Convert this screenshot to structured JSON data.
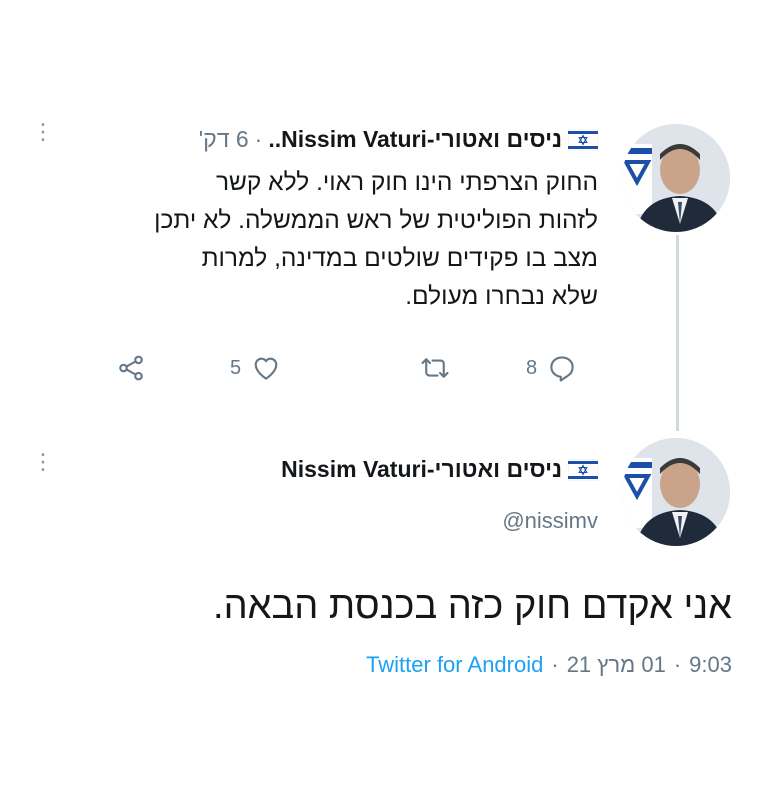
{
  "tweet1": {
    "display_name": "ניסים ואטורי-Nissim Vaturi..",
    "separator": "·",
    "time": "6 דק'",
    "text_lines": [
      "החוק הצרפתי הינו חוק ראוי. ללא קשר",
      "לזהות הפוליטית של ראש הממשלה. לא יתכן",
      "מצב בו פקידים שולטים במדינה, למרות",
      "שלא נבחרו מעולם."
    ],
    "reply_count": "8",
    "retweet_count": "",
    "like_count": "5"
  },
  "tweet2": {
    "display_name": "ניסים ואטורי-Nissim Vaturi",
    "handle": "@nissimv",
    "text": "אני אקדם חוק כזה בכנסת הבאה.",
    "time": "9:03",
    "date": "01 מרץ 21",
    "source": "Twitter for Android",
    "separator": "·"
  },
  "icons": [
    "israel-flag-icon",
    "more-options-icon",
    "reply-icon",
    "retweet-icon",
    "like-icon",
    "share-icon"
  ],
  "colors": {
    "link": "#1da1f2",
    "muted": "#657786",
    "text": "#14171a",
    "line": "#cfd9de"
  }
}
